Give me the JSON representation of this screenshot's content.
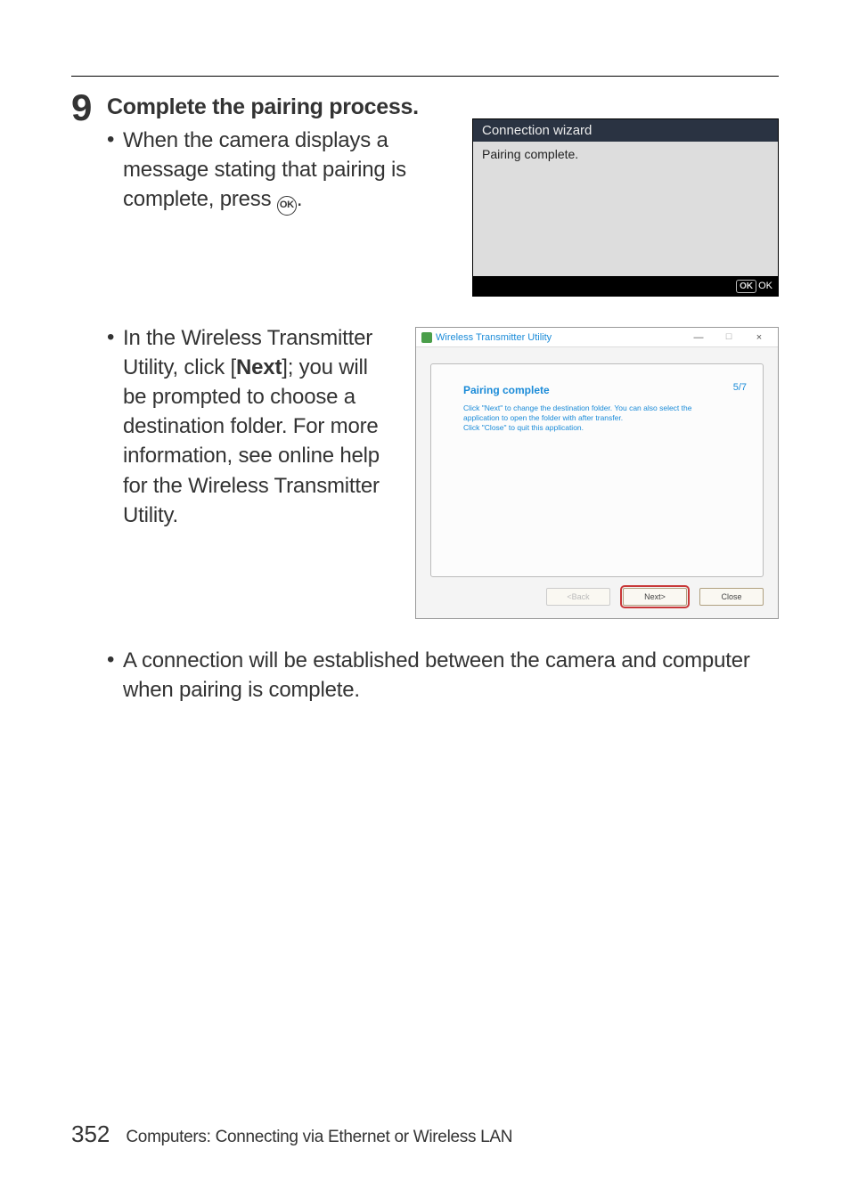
{
  "step": {
    "number": "9",
    "heading": "Complete the pairing process.",
    "bullet1_pre": "When the camera displays a message stating that pairing is complete, press ",
    "bullet1_post": ".",
    "ok_glyph": "OK",
    "bullet2_pre": "In the Wireless Transmitter Utility, click [",
    "bullet2_bold": "Next",
    "bullet2_post": "]; you will be prompted to choose a destination folder. For more information, see online help for the Wireless Transmitter Utility.",
    "bullet3": "A connection will be established between the camera and computer when pairing is complete."
  },
  "camera": {
    "title": "Connection wizard",
    "body": "Pairing complete.",
    "footer_ok": "OK",
    "footer_ok_label": "OK"
  },
  "utility": {
    "title": "Wireless Transmitter Utility",
    "minimize": "—",
    "maximize": "☐",
    "close": "×",
    "step_count": "5/7",
    "heading": "Pairing complete",
    "desc_l1": "Click \"Next\" to change the destination folder. You can also select the",
    "desc_l2": "application to open the folder with after transfer.",
    "desc_l3": "Click \"Close\" to quit this application.",
    "btn_back": "<Back",
    "btn_next": "Next>",
    "btn_close": "Close"
  },
  "footer": {
    "page": "352",
    "section": "Computers: Connecting via Ethernet or Wireless LAN"
  }
}
